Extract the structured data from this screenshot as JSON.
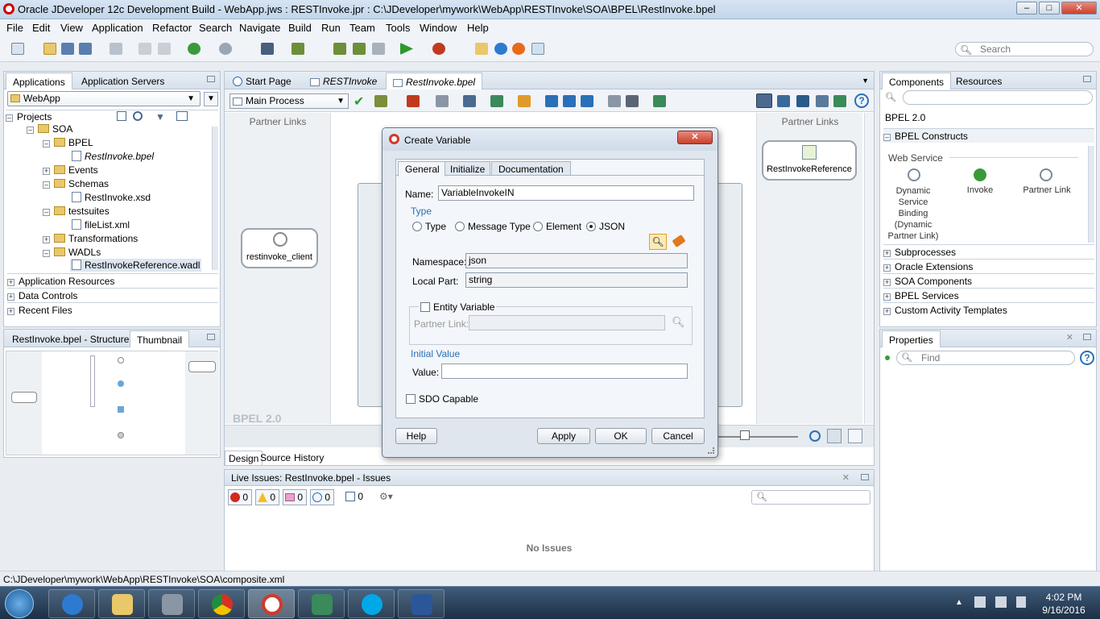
{
  "window": {
    "title": "Oracle JDeveloper 12c Development Build - WebApp.jws : RESTInvoke.jpr : C:\\JDeveloper\\mywork\\WebApp\\RESTInvoke\\SOA\\BPEL\\RestInvoke.bpel"
  },
  "menu": [
    "File",
    "Edit",
    "View",
    "Application",
    "Refactor",
    "Search",
    "Navigate",
    "Build",
    "Run",
    "Team",
    "Tools",
    "Window",
    "Help"
  ],
  "toolbar": {
    "search_placeholder": "Search"
  },
  "app_nav": {
    "tabs": [
      "Applications",
      "Application Servers"
    ],
    "app_selector": "WebApp",
    "projects_label": "Projects",
    "tree": [
      {
        "label": "SOA",
        "kind": "folder"
      },
      {
        "label": "BPEL",
        "kind": "folder"
      },
      {
        "label": "RestInvoke.bpel",
        "kind": "file"
      },
      {
        "label": "Events",
        "kind": "folder"
      },
      {
        "label": "Schemas",
        "kind": "folder"
      },
      {
        "label": "RestInvoke.xsd",
        "kind": "file"
      },
      {
        "label": "testsuites",
        "kind": "folder"
      },
      {
        "label": "fileList.xml",
        "kind": "file"
      },
      {
        "label": "Transformations",
        "kind": "folder"
      },
      {
        "label": "WADLs",
        "kind": "folder"
      },
      {
        "label": "RestInvokeReference.wadl",
        "kind": "file"
      }
    ],
    "sections": [
      "Application Resources",
      "Data Controls",
      "Recent Files"
    ]
  },
  "structure": {
    "tabs": [
      "RestInvoke.bpel - Structure",
      "Thumbnail"
    ]
  },
  "editor": {
    "tabs": [
      "Start Page",
      "RESTInvoke",
      "RestInvoke.bpel"
    ],
    "process_select": "Main Process",
    "partner_links_label": "Partner Links",
    "client_node": "restinvoke_client",
    "reference_node": "RestInvokeReference",
    "watermark": "BPEL 2.0",
    "bottom_tabs": [
      "Design",
      "Source",
      "History"
    ]
  },
  "dialog": {
    "title": "Create Variable",
    "tabs": [
      "General",
      "Initialize",
      "Documentation"
    ],
    "name_label": "Name:",
    "name_value": "VariableInvokeIN",
    "type_label": "Type",
    "type_options": [
      "Type",
      "Message Type",
      "Element",
      "JSON"
    ],
    "type_selected": "JSON",
    "namespace_label": "Namespace:",
    "namespace_value": "json",
    "localpart_label": "Local Part:",
    "localpart_value": "string",
    "entity_label": "Entity Variable",
    "partner_link_label": "Partner Link:",
    "initial_value_label": "Initial Value",
    "value_label": "Value:",
    "sdo_label": "SDO Capable",
    "buttons": {
      "help": "Help",
      "apply": "Apply",
      "ok": "OK",
      "cancel": "Cancel"
    }
  },
  "components": {
    "tabs": [
      "Components",
      "Resources"
    ],
    "version": "BPEL 2.0",
    "section": "BPEL Constructs",
    "group": "Web Service",
    "items": [
      "Dynamic Service Binding (Dynamic Partner Link)",
      "Invoke",
      "Partner Link"
    ],
    "collapsed": [
      "Subprocesses",
      "Oracle Extensions",
      "SOA Components",
      "BPEL Services",
      "Custom Activity Templates"
    ]
  },
  "properties": {
    "title": "Properties",
    "find_placeholder": "Find"
  },
  "issues": {
    "title": "Live Issues: RestInvoke.bpel - Issues",
    "counts": [
      "0",
      "0",
      "0",
      "0",
      "0"
    ],
    "empty_text": "No Issues"
  },
  "status_bar": {
    "path": "C:\\JDeveloper\\mywork\\WebApp\\RESTInvoke\\SOA\\composite.xml"
  },
  "taskbar": {
    "time": "4:02 PM",
    "date": "9/16/2016"
  },
  "colors": {
    "accent": "#2a6fb8",
    "panel_bg": "#e9edf2",
    "dialog_border": "#d03a2a"
  }
}
